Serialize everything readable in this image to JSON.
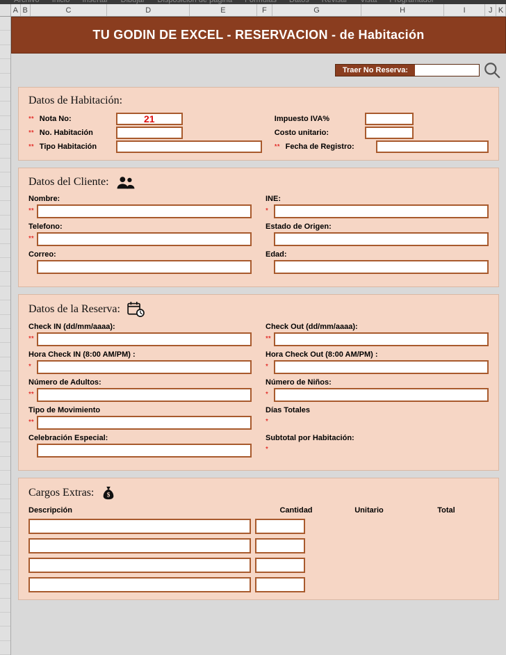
{
  "ribbon": [
    "Archivo",
    "Inicio",
    "Insertar",
    "Dibujar",
    "Disposición de página",
    "Fórmulas",
    "Datos",
    "Revisar",
    "Vista",
    "Programador"
  ],
  "columns": [
    "A",
    "B",
    "C",
    "D",
    "E",
    "F",
    "G",
    "H",
    "I",
    "J",
    "K"
  ],
  "title": "TU GODIN DE EXCEL - RESERVACION - de Habitación",
  "traer": {
    "label": "Traer No Reserva:",
    "value": ""
  },
  "hab": {
    "heading": "Datos de Habitación:",
    "nota_no_label": "Nota No:",
    "nota_no_value": "21",
    "no_hab_label": "No. Habitación",
    "tipo_label": "Tipo Habitación",
    "iva_label": "Impuesto IVA%",
    "costo_label": "Costo unitario:",
    "fecha_label": "Fecha de Registro:"
  },
  "cliente": {
    "heading": "Datos del Cliente:",
    "nombre": "Nombre:",
    "ine": "INE:",
    "telefono": "Telefono:",
    "origen": "Estado de Origen:",
    "correo": "Correo:",
    "edad": "Edad:"
  },
  "reserva": {
    "heading": "Datos de la Reserva:",
    "checkin": "Check IN (dd/mm/aaaa):",
    "checkout": "Check Out (dd/mm/aaaa):",
    "hin": "Hora Check IN (8:00 AM/PM) :",
    "hout": "Hora Check Out (8:00 AM/PM) :",
    "adultos": "Número de Adultos:",
    "ninos": "Número de Niños:",
    "mov": "Tipo de Movimiento",
    "dias": "Días Totales",
    "celeb": "Celebración Especial:",
    "subtotal": "Subtotal por Habitación:"
  },
  "cargos": {
    "heading": "Cargos Extras:",
    "h1": "Descripción",
    "h2": "Cantidad",
    "h3": "Unitario",
    "h4": "Total"
  }
}
